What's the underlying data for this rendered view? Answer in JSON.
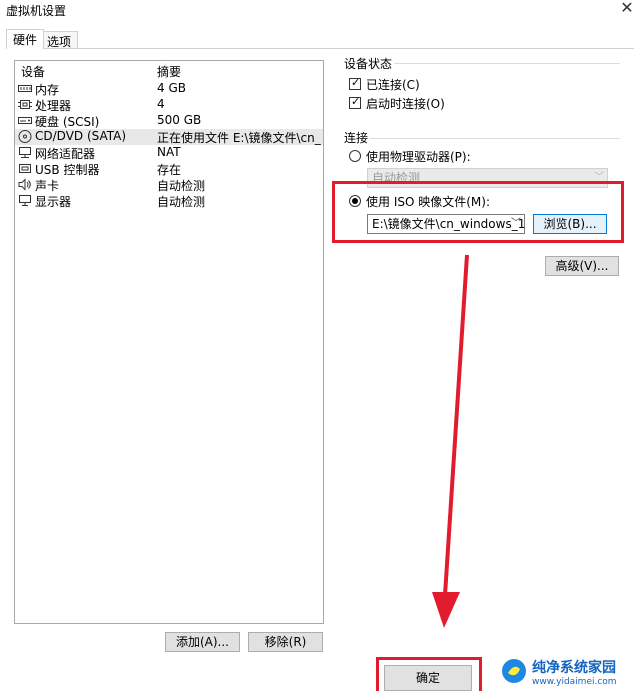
{
  "window": {
    "title": "虚拟机设置",
    "close_glyph": "✕"
  },
  "tabs": [
    {
      "label": "硬件",
      "active": true
    },
    {
      "label": "选项",
      "active": false
    }
  ],
  "device_list": {
    "headers": {
      "device": "设备",
      "summary": "摘要"
    },
    "rows": [
      {
        "icon": "memory-icon",
        "name": "内存",
        "summary": "4 GB"
      },
      {
        "icon": "cpu-icon",
        "name": "处理器",
        "summary": "4"
      },
      {
        "icon": "hard-disk-icon",
        "name": "硬盘 (SCSI)",
        "summary": "500 GB"
      },
      {
        "icon": "cd-dvd-icon",
        "name": "CD/DVD (SATA)",
        "summary": "正在使用文件 E:\\镜像文件\\cn_...",
        "selected": true
      },
      {
        "icon": "network-adapter-icon",
        "name": "网络适配器",
        "summary": "NAT"
      },
      {
        "icon": "usb-icon",
        "name": "USB 控制器",
        "summary": "存在"
      },
      {
        "icon": "sound-card-icon",
        "name": "声卡",
        "summary": "自动检测"
      },
      {
        "icon": "display-icon",
        "name": "显示器",
        "summary": "自动检测"
      }
    ]
  },
  "list_buttons": {
    "add": "添加(A)...",
    "remove": "移除(R)"
  },
  "device_status": {
    "label": "设备状态",
    "connected": {
      "label": "已连接(C)",
      "checked": true
    },
    "connect_at_power_on": {
      "label": "启动时连接(O)",
      "checked": true
    }
  },
  "connection": {
    "label": "连接",
    "physical_drive": {
      "label": "使用物理驱动器(P):",
      "selected": false
    },
    "physical_drive_value": "自动检测",
    "iso_image": {
      "label": "使用 ISO 映像文件(M):",
      "selected": true
    },
    "iso_path": "E:\\镜像文件\\cn_windows_1(",
    "browse": "浏览(B)...",
    "advanced": "高级(V)..."
  },
  "footer": {
    "ok": "确定"
  },
  "watermark": {
    "brand": "纯净系统家园",
    "url": "www.yidaimei.com"
  },
  "colors": {
    "highlight_red": "#e31b2e",
    "selected_row": "#e8e8e8"
  }
}
